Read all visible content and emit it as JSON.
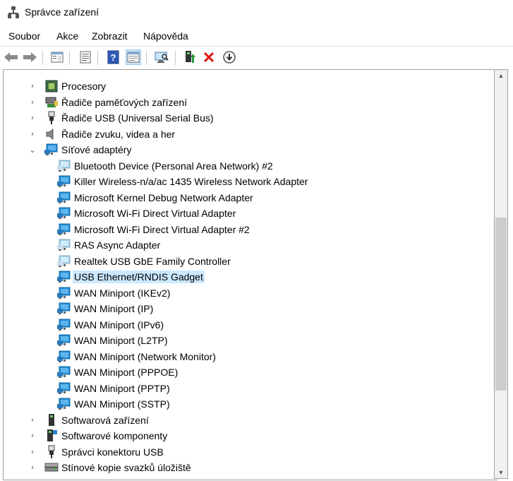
{
  "window": {
    "title": "Správce zařízení"
  },
  "menu": [
    "Soubor",
    "Akce",
    "Zobrazit",
    "Nápověda"
  ],
  "toolbar": [
    {
      "name": "back-icon"
    },
    {
      "name": "forward-icon"
    },
    {
      "name": "properties-view-icon"
    },
    {
      "name": "device-list-icon"
    },
    {
      "name": "help-icon"
    },
    {
      "name": "show-hidden-icon"
    },
    {
      "name": "scan-hardware-icon"
    },
    {
      "name": "update-driver-icon"
    },
    {
      "name": "uninstall-icon"
    },
    {
      "name": "disable-device-icon"
    }
  ],
  "tree": {
    "categories_top": [
      {
        "label": "Procesory",
        "icon": "cpu-icon",
        "expanded": false
      },
      {
        "label": "Řadiče paměťových zařízení",
        "icon": "storage-controller-icon",
        "expanded": false
      },
      {
        "label": "Řadiče USB (Universal Serial Bus)",
        "icon": "usb-icon",
        "expanded": false
      },
      {
        "label": "Řadiče zvuku, videa a her",
        "icon": "speaker-icon",
        "expanded": false
      },
      {
        "label": "Síťové adaptéry",
        "icon": "network-icon",
        "expanded": true
      }
    ],
    "network_children": [
      {
        "label": "Bluetooth Device (Personal Area Network) #2",
        "hidden": true
      },
      {
        "label": "Killer Wireless-n/a/ac 1435 Wireless Network Adapter",
        "hidden": false
      },
      {
        "label": "Microsoft Kernel Debug Network Adapter",
        "hidden": false
      },
      {
        "label": "Microsoft Wi-Fi Direct Virtual Adapter",
        "hidden": false
      },
      {
        "label": "Microsoft Wi-Fi Direct Virtual Adapter #2",
        "hidden": false
      },
      {
        "label": "RAS Async Adapter",
        "hidden": true
      },
      {
        "label": "Realtek USB GbE Family Controller",
        "hidden": true
      },
      {
        "label": "USB Ethernet/RNDIS Gadget",
        "hidden": false,
        "selected": true
      },
      {
        "label": "WAN Miniport (IKEv2)",
        "hidden": false
      },
      {
        "label": "WAN Miniport (IP)",
        "hidden": false
      },
      {
        "label": "WAN Miniport (IPv6)",
        "hidden": false
      },
      {
        "label": "WAN Miniport (L2TP)",
        "hidden": false
      },
      {
        "label": "WAN Miniport (Network Monitor)",
        "hidden": false
      },
      {
        "label": "WAN Miniport (PPPOE)",
        "hidden": false
      },
      {
        "label": "WAN Miniport (PPTP)",
        "hidden": false
      },
      {
        "label": "WAN Miniport (SSTP)",
        "hidden": false
      }
    ],
    "categories_bottom": [
      {
        "label": "Softwarová zařízení",
        "icon": "software-device-icon",
        "expanded": false
      },
      {
        "label": "Softwarové komponenty",
        "icon": "software-component-icon",
        "expanded": false
      },
      {
        "label": "Správci konektoru USB",
        "icon": "usb-connector-icon",
        "expanded": false
      },
      {
        "label": "Stínové kopie svazků úložiště",
        "icon": "volume-shadow-icon",
        "expanded": false
      }
    ]
  },
  "colors": {
    "network": "#1e90d6",
    "network_hidden": "#9fd0ef",
    "selection": "#cce8ff"
  }
}
